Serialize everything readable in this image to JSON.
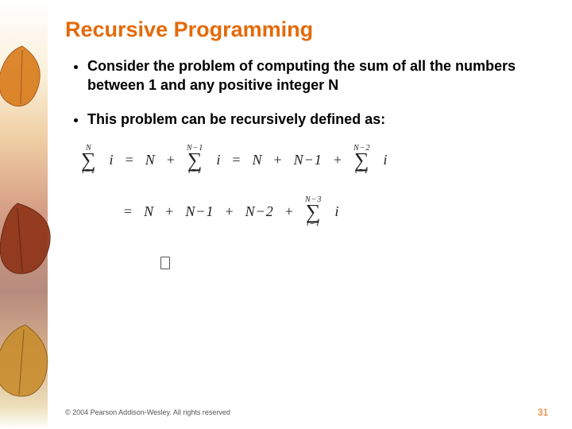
{
  "title": "Recursive Programming",
  "bullets": [
    "Consider the problem of computing the sum of all the numbers between 1 and any positive integer N",
    "This problem can be recursively defined as:"
  ],
  "math": {
    "row1_lead_upper": "N",
    "row1_lead_i": "i",
    "row1_lead_lower": "i=1",
    "eq": "=",
    "plus": "+",
    "N": "N",
    "Nm1": "N−1",
    "Nm2": "N−2",
    "sum_i": "i",
    "lower": "i=1",
    "upper_Nm1": "N−1",
    "upper_Nm2": "N−2",
    "upper_Nm3": "N−3"
  },
  "footer": "© 2004 Pearson Addison-Wesley. All rights reserved",
  "page": "31"
}
